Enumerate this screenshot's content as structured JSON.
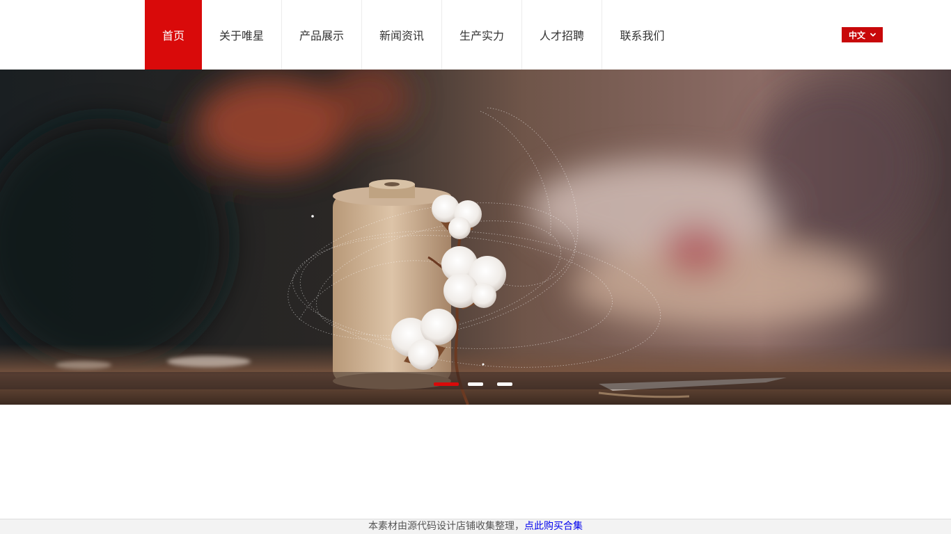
{
  "nav": {
    "items": [
      {
        "label": "首页",
        "active": true
      },
      {
        "label": "关于唯星",
        "active": false
      },
      {
        "label": "产品展示",
        "active": false
      },
      {
        "label": "新闻资讯",
        "active": false
      },
      {
        "label": "生产实力",
        "active": false
      },
      {
        "label": "人才招聘",
        "active": false
      },
      {
        "label": "联系我们",
        "active": false
      }
    ]
  },
  "language": {
    "selected": "中文",
    "icon": "chevron-down-icon"
  },
  "banner": {
    "slide_count": 3,
    "active_slide": 1
  },
  "footer": {
    "notice": "本素材由源代码设计店铺收集整理，",
    "link_label": "点此购买合集"
  },
  "colors": {
    "accent": "#d90a0a",
    "lang_bg": "#c8080a",
    "link": "#0000ee"
  }
}
